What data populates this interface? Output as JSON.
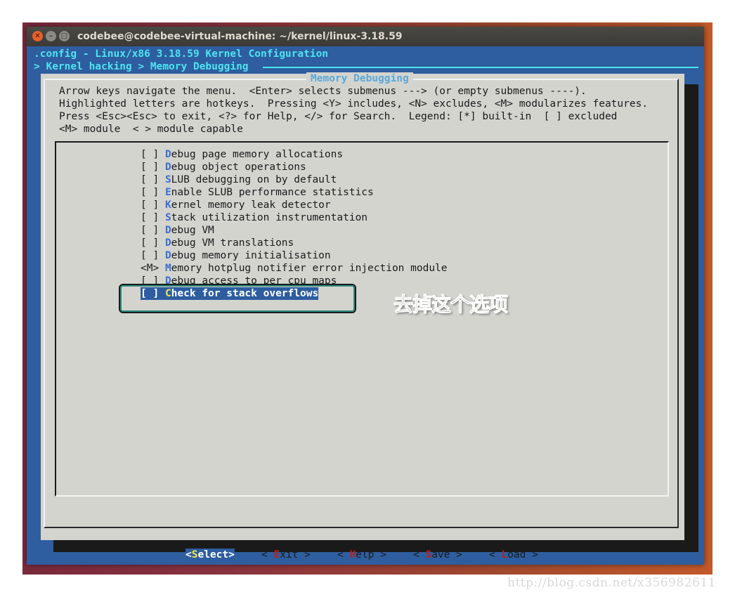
{
  "window": {
    "title": "codebee@codebee-virtual-machine: ~/kernel/linux-3.18.59",
    "close_glyph": "✕",
    "minimize_glyph": "–",
    "maximize_glyph": "□"
  },
  "header": {
    "line1": ".config - Linux/x86 3.18.59 Kernel Configuration",
    "breadcrumb": "> Kernel hacking > Memory Debugging"
  },
  "dialog": {
    "title": "Memory Debugging",
    "help_lines": [
      "Arrow keys navigate the menu.  <Enter> selects submenus ---> (or empty submenus ----).",
      "Highlighted letters are hotkeys.  Pressing <Y> includes, <N> excludes, <M> modularizes features.",
      "Press <Esc><Esc> to exit, <?> for Help, </> for Search.  Legend: [*] built-in  [ ] excluded",
      "<M> module  < > module capable"
    ]
  },
  "menu": {
    "items": [
      {
        "state": "[ ]",
        "hotkey": "D",
        "rest": "ebug page memory allocations"
      },
      {
        "state": "[ ]",
        "hotkey": "D",
        "rest": "ebug object operations"
      },
      {
        "state": "[ ]",
        "hotkey": "S",
        "rest": "LUB debugging on by default"
      },
      {
        "state": "[ ]",
        "hotkey": "E",
        "rest": "nable SLUB performance statistics"
      },
      {
        "state": "[ ]",
        "hotkey": "K",
        "rest": "ernel memory leak detector"
      },
      {
        "state": "[ ]",
        "hotkey": "S",
        "rest": "tack utilization instrumentation"
      },
      {
        "state": "[ ]",
        "hotkey": "D",
        "rest": "ebug VM"
      },
      {
        "state": "[ ]",
        "hotkey": "D",
        "rest": "ebug VM translations"
      },
      {
        "state": "[ ]",
        "hotkey": "D",
        "rest": "ebug memory initialisation"
      },
      {
        "state": "<M>",
        "hotkey": "M",
        "rest": "emory hotplug notifier error injection module"
      },
      {
        "state": "[ ]",
        "hotkey": "D",
        "rest": "ebug access to per_cpu maps"
      },
      {
        "state": "[ ]",
        "hotkey": "C",
        "rest": "heck for stack overflows",
        "selected": true
      }
    ]
  },
  "buttons": {
    "select": {
      "open": "<",
      "hotkey": "S",
      "rest": "elect",
      "close": ">"
    },
    "exit": {
      "open": "< ",
      "hotkey": "E",
      "rest": "xit",
      "close": " >"
    },
    "help": {
      "open": "< ",
      "hotkey": "H",
      "rest": "elp",
      "close": " >"
    },
    "save": {
      "open": "< ",
      "hotkey": "S",
      "rest": "ave",
      "close": " >"
    },
    "load": {
      "open": "< ",
      "hotkey": "L",
      "rest": "oad",
      "close": " >"
    }
  },
  "annotation": {
    "text": "去掉这个选项"
  },
  "watermark": {
    "text": "http://blog.csdn.net/x356982611"
  },
  "colors": {
    "terminal_bg": "#2e5e9f",
    "dialog_bg": "#d4d4cf",
    "header_text": "#4fe3f0",
    "selection_bg": "#2d5d9f",
    "hotkey": "#3a6ed0",
    "button_hotkey": "#c0201a"
  }
}
